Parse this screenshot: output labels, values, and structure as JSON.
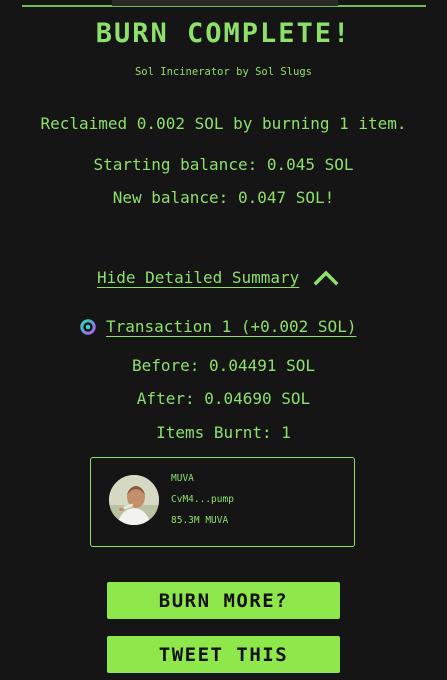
{
  "header": {
    "title": "BURN COMPLETE!",
    "subtitle": "Sol Incinerator by Sol Slugs"
  },
  "summary": {
    "reclaimed": "Reclaimed 0.002 SOL by burning 1 item.",
    "starting_balance": "Starting balance: 0.045 SOL",
    "new_balance": "New balance: 0.047 SOL!"
  },
  "details": {
    "toggle_label": "Hide Detailed Summary",
    "toggle_icon": "chevron-up-icon",
    "transactions": [
      {
        "link_label": "Transaction 1 (+0.002 SOL)",
        "explorer_icon": "solscan-icon",
        "before": "Before: 0.04491 SOL",
        "after": "After: 0.04690 SOL",
        "items_burnt": "Items Burnt: 1",
        "items": [
          {
            "name": "MUVA",
            "address": "CvM4...pump",
            "amount": "85.3M MUVA"
          }
        ]
      }
    ]
  },
  "actions": {
    "burn_more": "BURN MORE?",
    "tweet": "TWEET THIS"
  },
  "colors": {
    "background": "#151515",
    "accent": "#8ee06a",
    "button": "#8ee84b",
    "button_text": "#111111"
  }
}
